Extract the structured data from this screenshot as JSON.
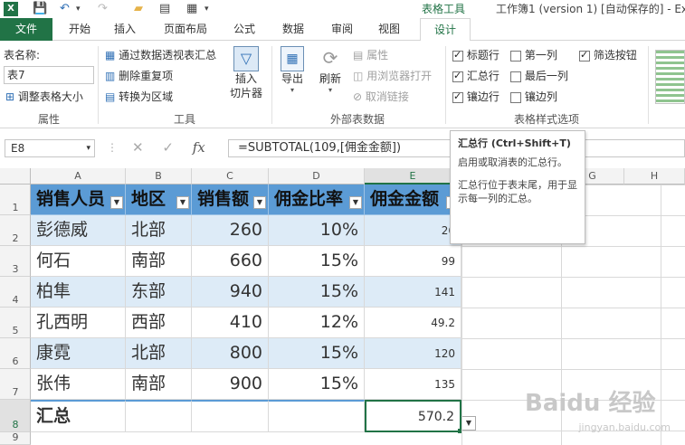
{
  "titlebar": {
    "table_tools_label": "表格工具",
    "window_title": "工作簿1 (version 1) [自动保存的] - Exc"
  },
  "tabs": [
    "文件",
    "开始",
    "插入",
    "页面布局",
    "公式",
    "数据",
    "审阅",
    "视图",
    "设计"
  ],
  "ribbon": {
    "properties": {
      "table_name_label": "表名称:",
      "table_name_value": "表7",
      "resize_label": "调整表格大小",
      "group_label": "属性"
    },
    "tools": {
      "pivot_label": "通过数据透视表汇总",
      "remove_dup_label": "删除重复项",
      "convert_label": "转换为区域",
      "slicer_label_1": "插入",
      "slicer_label_2": "切片器",
      "group_label": "工具"
    },
    "external": {
      "export_label": "导出",
      "refresh_label": "刷新",
      "props_label": "属性",
      "browser_label": "用浏览器打开",
      "unlink_label": "取消链接",
      "group_label": "外部表数据"
    },
    "style_options": {
      "header_row": {
        "label": "标题行",
        "checked": true
      },
      "total_row": {
        "label": "汇总行",
        "checked": true
      },
      "banded_rows": {
        "label": "镶边行",
        "checked": true
      },
      "first_col": {
        "label": "第一列",
        "checked": false
      },
      "last_col": {
        "label": "最后一列",
        "checked": false
      },
      "banded_cols": {
        "label": "镶边列",
        "checked": false
      },
      "filter_btn": {
        "label": "筛选按钮",
        "checked": true
      },
      "group_label": "表格样式选项"
    }
  },
  "formula_bar": {
    "name_box": "E8",
    "formula": "=SUBTOTAL(109,[佣金金额])"
  },
  "grid": {
    "columns": [
      "A",
      "B",
      "C",
      "D",
      "E",
      "F",
      "G",
      "H"
    ],
    "rows": [
      "1",
      "2",
      "3",
      "4",
      "5",
      "6",
      "7",
      "8",
      "9"
    ],
    "headers": [
      "销售人员",
      "地区",
      "销售额",
      "佣金比率",
      "佣金金额"
    ],
    "data": [
      [
        "彭德威",
        "北部",
        "260",
        "10%",
        "26"
      ],
      [
        "何石",
        "南部",
        "660",
        "15%",
        "99"
      ],
      [
        "柏隼",
        "东部",
        "940",
        "15%",
        "141"
      ],
      [
        "孔西明",
        "西部",
        "410",
        "12%",
        "49.2"
      ],
      [
        "康霓",
        "北部",
        "800",
        "15%",
        "120"
      ],
      [
        "张伟",
        "南部",
        "900",
        "15%",
        "135"
      ]
    ],
    "total_label": "汇总",
    "total_value": "570.2"
  },
  "tooltip": {
    "title": "汇总行 (Ctrl+Shift+T)",
    "line1": "启用或取消表的汇总行。",
    "line2": "汇总行位于表末尾，用于显示每一列的汇总。"
  },
  "watermark": {
    "brand": "Baidu 经验",
    "url": "jingyan.baidu.com"
  },
  "colors": {
    "excel_green": "#217346",
    "table_header": "#5b9bd5",
    "table_band": "#ddebf7"
  }
}
